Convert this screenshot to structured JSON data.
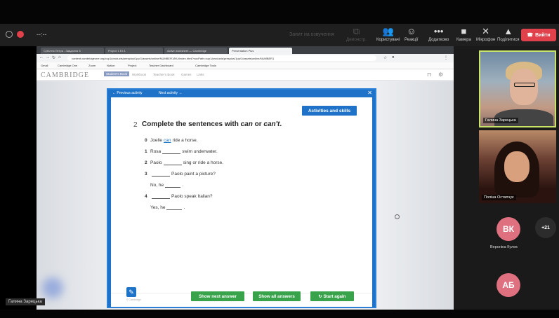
{
  "zoom": {
    "title": "--:--",
    "recording_label": "Запит на озвучення",
    "toolbar": [
      {
        "icon": "share-screen-icon",
        "glyph": "⧉",
        "label": "Демонстр.",
        "dim": true
      },
      {
        "icon": "participants-icon",
        "glyph": "👥",
        "label": "Користувачі"
      },
      {
        "icon": "reactions-icon",
        "glyph": "☺",
        "label": "Реакції"
      },
      {
        "icon": "more-icon",
        "glyph": "•••",
        "label": "Додатково"
      },
      {
        "icon": "camera-icon",
        "glyph": "■",
        "label": "Камера"
      },
      {
        "icon": "microphone-icon",
        "glyph": "✕",
        "label": "Мікрофон"
      },
      {
        "icon": "share-icon",
        "glyph": "▲",
        "label": "Поділитися"
      }
    ],
    "leave_label": "Вийти"
  },
  "browser": {
    "tabs": [
      "Суботня Петра - Завдання 6",
      "Project 1 Ex 1",
      "Active worksheet — Cambridge",
      "Presentation Plus"
    ],
    "address": "content.cambridgeone.org/cup1/products/presplus/1pp/1/assets/online/NUMBER1/NU/index.html?nocPath=cup1/products/presplus/1pp/1/assets/online/NUMBER1",
    "bookmarks": [
      "Gmail",
      "Cambridge One",
      "Zoom",
      "Notion",
      "Project",
      "Teacher Dashboard",
      "Cambridge Tools"
    ]
  },
  "cambridge": {
    "logo": "CAMBRIDGE",
    "tabs": [
      "Student's Book",
      "Workbook",
      "Teacher's Book",
      "Games",
      "Links"
    ]
  },
  "activity": {
    "prev": "← Previous activity",
    "next": "Next activity →",
    "skills_button": "Activities and skills",
    "number": "2",
    "title_pre": "Complete the sentences with ",
    "title_can": "can",
    "title_or": " or ",
    "title_cant": "can't",
    "title_post": ".",
    "line0": {
      "n": "0",
      "pre": "Joelle",
      "answer": "can",
      "post": "ride a horse."
    },
    "line1": {
      "n": "1",
      "pre": "Rosa",
      "post": "swim underwater."
    },
    "line2": {
      "n": "2",
      "pre": "Paolo",
      "post": "sing or ride a horse."
    },
    "line3": {
      "n": "3",
      "post": "Paolo paint a picture?"
    },
    "line3b": {
      "pre": "No, he",
      "post": "."
    },
    "line4": {
      "n": "4",
      "post": "Paolo speak Italian?"
    },
    "line4b": {
      "pre": "Yes, he",
      "post": "."
    },
    "copyright": "© Cambridge",
    "buttons": [
      "Show next answer",
      "Show all answers",
      "↻ Start again"
    ]
  },
  "participants": [
    {
      "name": "Галина Зарецька"
    },
    {
      "name": "Поліна Остапчук"
    },
    {
      "initials": "ВК",
      "name": "Вероніка Кулик"
    },
    {
      "more": "+21"
    },
    {
      "initials": "АБ"
    }
  ],
  "active_speaker": "Галина Зарецька"
}
